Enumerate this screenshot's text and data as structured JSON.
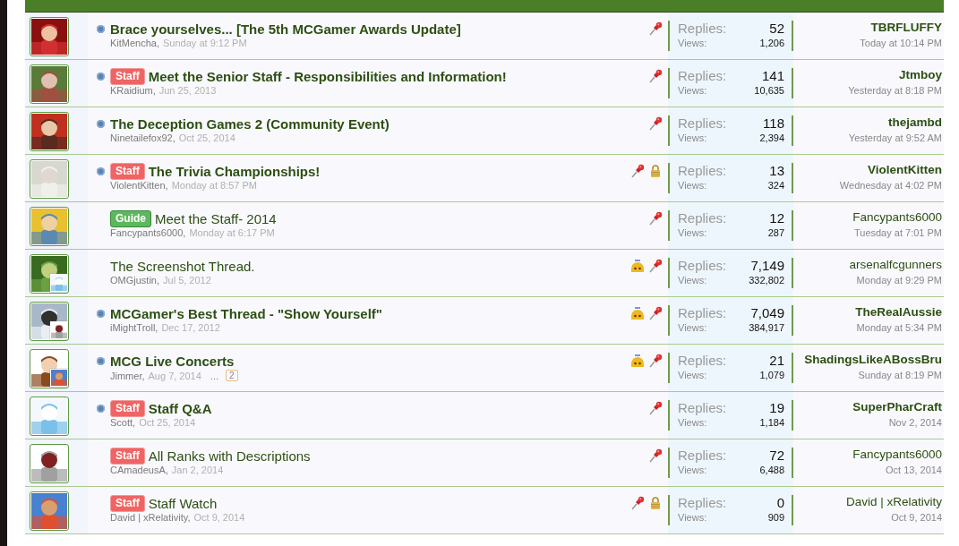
{
  "threads": [
    {
      "title": "Brace yourselves... [The 5th MCGamer Awards Update]",
      "unread": true,
      "author": "KitMencha,",
      "start_date": "Sunday at 9:12 PM",
      "sticky": true,
      "locked": false,
      "watched": false,
      "participant_avatar": false,
      "replies_label": "Replies:",
      "replies": "52",
      "views_label": "Views:",
      "views": "1,206",
      "last_poster": "TBRFLUFFY",
      "last_date": "Today at 10:14 PM"
    },
    {
      "title": "Meet the Senior Staff - Responsibilities and Information!",
      "prefix": {
        "label": "Staff",
        "kind": "staff"
      },
      "unread": true,
      "author": "KRaidium,",
      "start_date": "Jun 25, 2013",
      "sticky": true,
      "locked": false,
      "watched": false,
      "participant_avatar": false,
      "replies_label": "Replies:",
      "replies": "141",
      "views_label": "Views:",
      "views": "10,635",
      "last_poster": "Jtmboy",
      "last_date": "Yesterday at 8:18 PM"
    },
    {
      "title": "The Deception Games 2 (Community Event)",
      "unread": true,
      "author": "Ninetailefox92,",
      "start_date": "Oct 25, 2014",
      "sticky": true,
      "locked": false,
      "watched": false,
      "participant_avatar": false,
      "replies_label": "Replies:",
      "replies": "118",
      "views_label": "Views:",
      "views": "2,394",
      "last_poster": "thejambd",
      "last_date": "Yesterday at 9:52 AM"
    },
    {
      "title": "The Trivia Championships!",
      "prefix": {
        "label": "Staff",
        "kind": "staff"
      },
      "unread": true,
      "author": "ViolentKitten,",
      "start_date": "Monday at 8:57 PM",
      "sticky": true,
      "locked": true,
      "watched": false,
      "participant_avatar": false,
      "replies_label": "Replies:",
      "replies": "13",
      "views_label": "Views:",
      "views": "324",
      "last_poster": "ViolentKitten",
      "last_date": "Wednesday at 4:02 PM"
    },
    {
      "title": "Meet the Staff- 2014",
      "prefix": {
        "label": "Guide",
        "kind": "guide"
      },
      "unread": false,
      "author": "Fancypants6000,",
      "start_date": "Monday at 6:17 PM",
      "sticky": true,
      "locked": false,
      "watched": false,
      "participant_avatar": false,
      "replies_label": "Replies:",
      "replies": "12",
      "views_label": "Views:",
      "views": "287",
      "last_poster": "Fancypants6000",
      "last_date": "Tuesday at 7:01 PM"
    },
    {
      "title": "The Screenshot Thread.",
      "unread": false,
      "author": "OMGjustin,",
      "start_date": "Jul 5, 2012",
      "sticky": true,
      "locked": false,
      "watched": true,
      "participant_avatar": true,
      "replies_label": "Replies:",
      "replies": "7,149",
      "views_label": "Views:",
      "views": "332,802",
      "last_poster": "arsenalfcgunners",
      "last_date": "Monday at 9:29 PM"
    },
    {
      "title": "MCGamer's Best Thread - \"Show Yourself\"",
      "unread": true,
      "author": "iMightTroll,",
      "start_date": "Dec 17, 2012",
      "sticky": true,
      "locked": false,
      "watched": true,
      "participant_avatar": true,
      "replies_label": "Replies:",
      "replies": "7,049",
      "views_label": "Views:",
      "views": "384,917",
      "last_poster": "TheRealAussie",
      "last_date": "Monday at 5:34 PM"
    },
    {
      "title": "MCG Live Concerts",
      "unread": true,
      "author": "Jimmer,",
      "start_date": "Aug 7, 2014",
      "pages": {
        "ellipsis": "...",
        "links": [
          "2"
        ]
      },
      "sticky": true,
      "locked": false,
      "watched": true,
      "participant_avatar": true,
      "replies_label": "Replies:",
      "replies": "21",
      "views_label": "Views:",
      "views": "1,079",
      "last_poster": "ShadingsLikeABossBru",
      "last_date": "Sunday at 8:19 PM"
    },
    {
      "title": "Staff Q&A",
      "prefix": {
        "label": "Staff",
        "kind": "staff"
      },
      "unread": true,
      "author": "Scott,",
      "start_date": "Oct 25, 2014",
      "sticky": true,
      "locked": false,
      "watched": false,
      "participant_avatar": false,
      "replies_label": "Replies:",
      "replies": "19",
      "views_label": "Views:",
      "views": "1,184",
      "last_poster": "SuperPharCraft",
      "last_date": "Nov 2, 2014"
    },
    {
      "title": "All Ranks with Descriptions",
      "prefix": {
        "label": "Staff",
        "kind": "staff"
      },
      "unread": false,
      "author": "CAmadeusA,",
      "start_date": "Jan 2, 2014",
      "sticky": true,
      "locked": false,
      "watched": false,
      "participant_avatar": false,
      "replies_label": "Replies:",
      "replies": "72",
      "views_label": "Views:",
      "views": "6,488",
      "last_poster": "Fancypants6000",
      "last_date": "Oct 13, 2014"
    },
    {
      "title": "Staff Watch",
      "prefix": {
        "label": "Staff",
        "kind": "staff"
      },
      "unread": false,
      "author": "David | xRelativity,",
      "start_date": "Oct 9, 2014",
      "sticky": true,
      "locked": true,
      "watched": false,
      "participant_avatar": false,
      "replies_label": "Replies:",
      "replies": "0",
      "views_label": "Views:",
      "views": "909",
      "last_poster": "David | xRelativity",
      "last_date": "Oct 9, 2014"
    }
  ],
  "page_edge": true
}
